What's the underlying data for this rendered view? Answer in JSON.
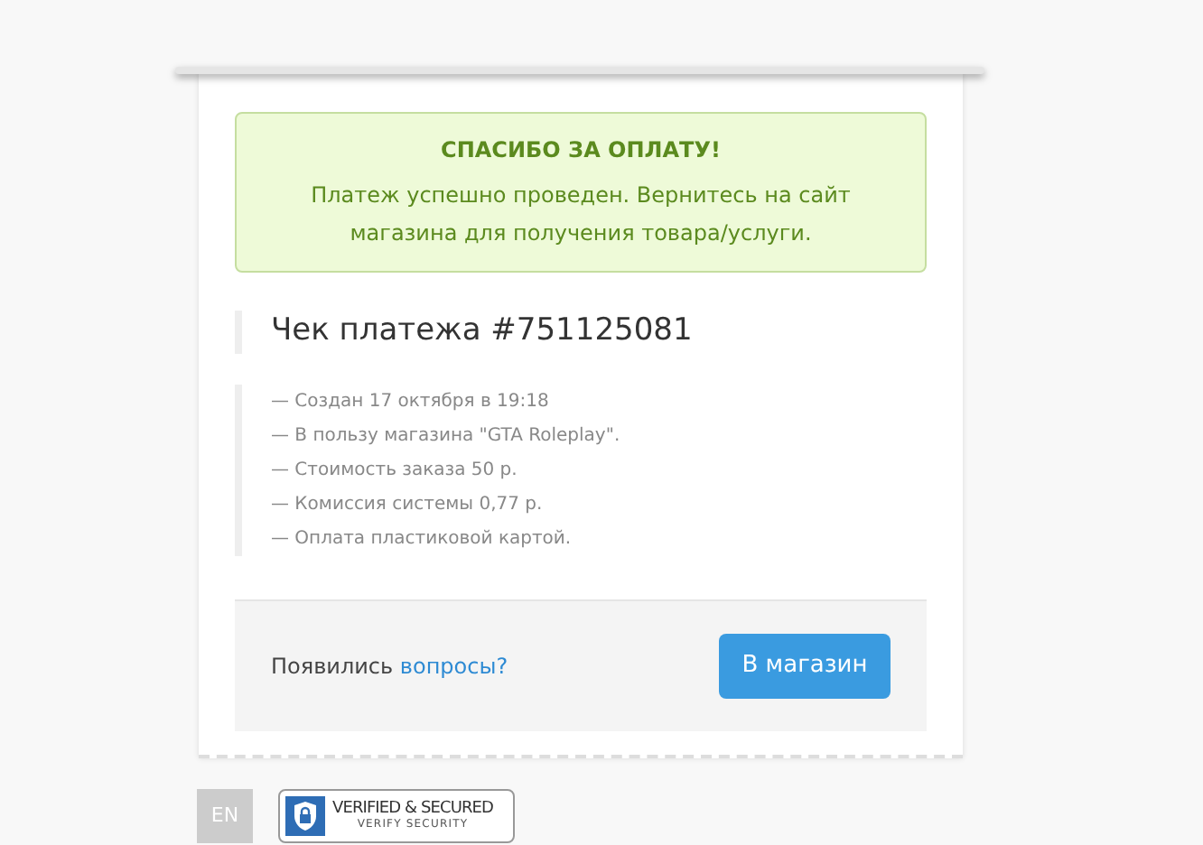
{
  "alert": {
    "title": "СПАСИБО ЗА ОПЛАТУ!",
    "text": "Платеж успешно проведен. Вернитесь на сайт магазина для получения товара/услуги."
  },
  "receipt": {
    "title": "Чек платежа #751125081",
    "details": [
      "— Создан 17 октября в 19:18",
      "— В пользу магазина \"GTA Roleplay\".",
      "— Стоимость заказа 50 р.",
      "— Комиссия системы 0,77 р.",
      "— Оплата пластиковой картой."
    ]
  },
  "footer": {
    "question": "Появились",
    "link": "вопросы?",
    "button": "В магазин"
  },
  "language": "EN",
  "badge": {
    "title": "VERIFIED & SECURED",
    "subtitle": "VERIFY SECURITY"
  }
}
